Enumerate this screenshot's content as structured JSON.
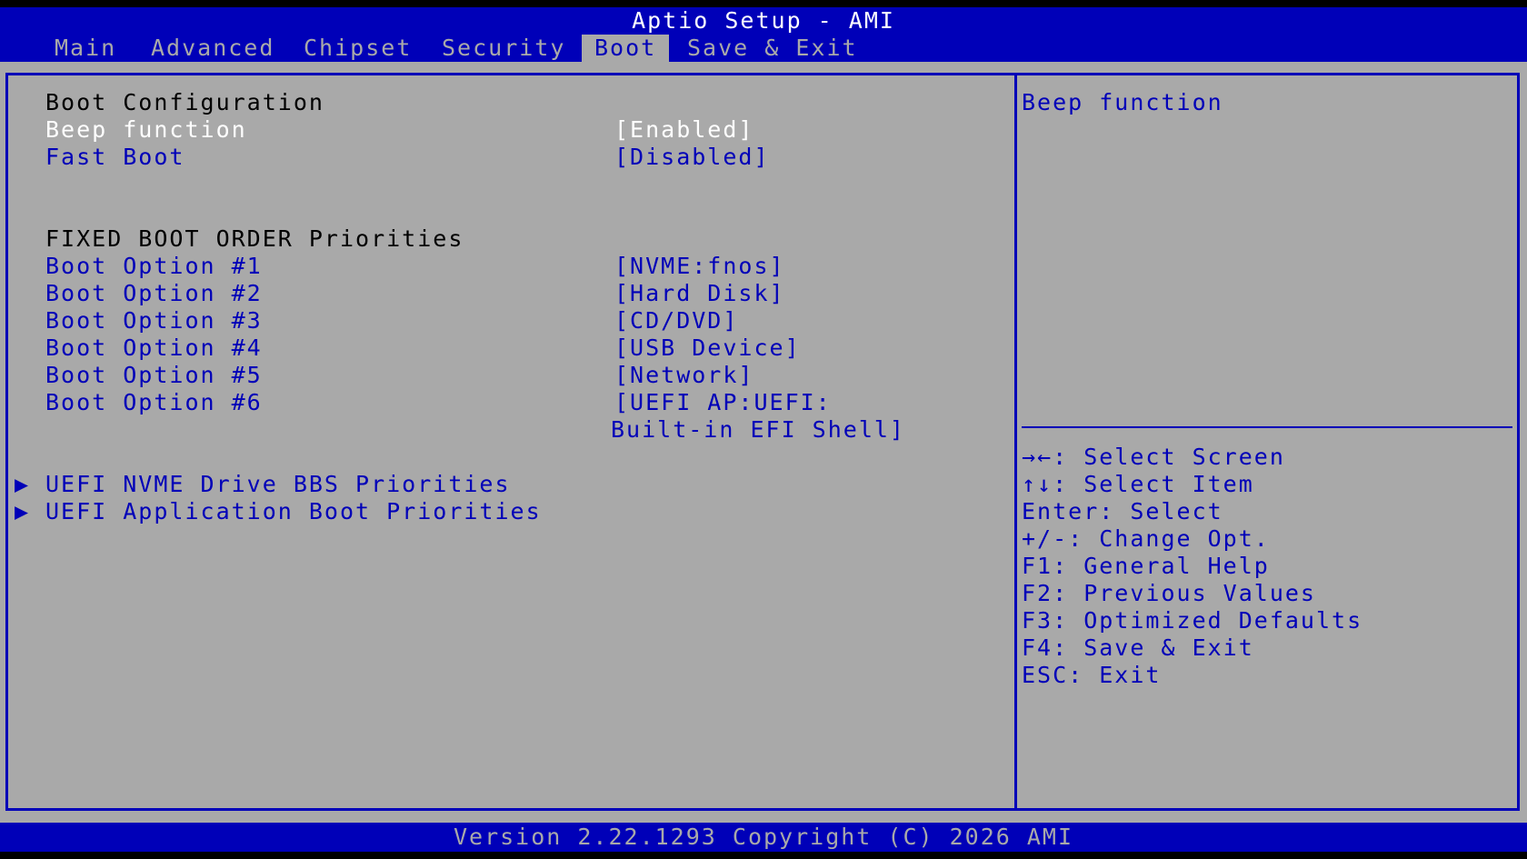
{
  "window": {
    "title": "Aptio Setup - AMI"
  },
  "tabs": [
    {
      "label": "Main"
    },
    {
      "label": "Advanced"
    },
    {
      "label": "Chipset"
    },
    {
      "label": "Security"
    },
    {
      "label": "Boot"
    },
    {
      "label": "Save & Exit"
    }
  ],
  "active_tab": "Boot",
  "boot": {
    "section_title": "Boot Configuration",
    "beep": {
      "label": "Beep function",
      "value": "[Enabled]"
    },
    "fast_boot": {
      "label": "Fast Boot",
      "value": "[Disabled]"
    },
    "order_title": "FIXED BOOT ORDER Priorities",
    "options": [
      {
        "label": "Boot Option #1",
        "value": "[NVME:fnos]"
      },
      {
        "label": "Boot Option #2",
        "value": "[Hard Disk]"
      },
      {
        "label": "Boot Option #3",
        "value": "[CD/DVD]"
      },
      {
        "label": "Boot Option #4",
        "value": "[USB Device]"
      },
      {
        "label": "Boot Option #5",
        "value": "[Network]"
      },
      {
        "label": "Boot Option #6",
        "value": "[UEFI AP:UEFI:",
        "value_line2": "Built-in EFI Shell]"
      }
    ],
    "submenus": [
      {
        "arrow": "▶",
        "label": "UEFI NVME Drive BBS Priorities"
      },
      {
        "arrow": "▶",
        "label": "UEFI Application Boot Priorities"
      }
    ]
  },
  "help": {
    "text": "Beep function",
    "keys": [
      "→←: Select Screen",
      "↑↓: Select Item",
      "Enter: Select",
      "+/-: Change Opt.",
      "F1: General Help",
      "F2: Previous Values",
      "F3: Optimized Defaults",
      "F4: Save & Exit",
      "ESC: Exit"
    ]
  },
  "footer": {
    "version": "Version 2.22.1293 Copyright (C) 2026 AMI"
  },
  "colors": {
    "bar_blue": "#0000b8",
    "panel_gray": "#a9a9a9",
    "selected_text": "#ffffff"
  }
}
